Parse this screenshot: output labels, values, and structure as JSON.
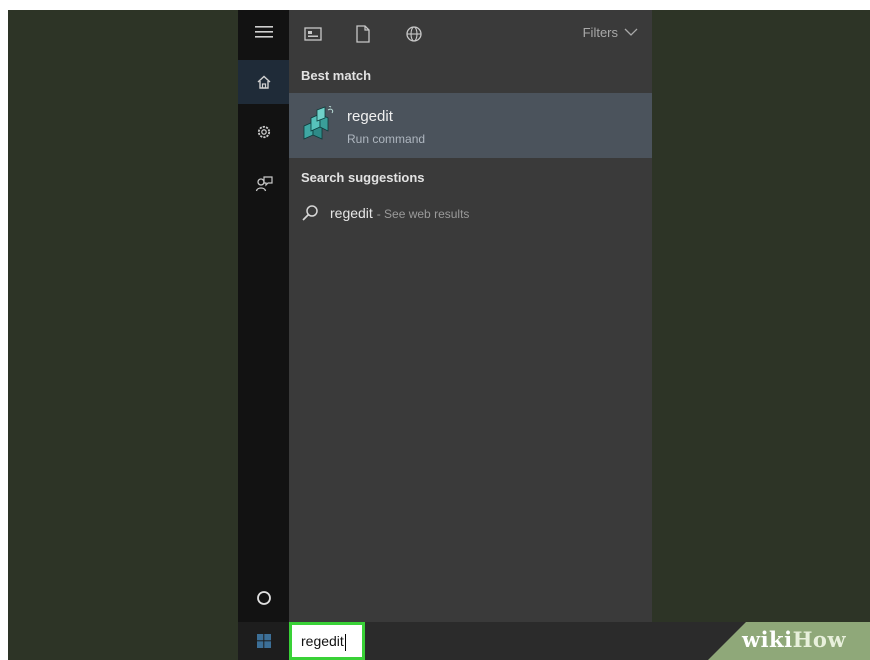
{
  "topbar": {
    "icons": [
      "apps-icon",
      "documents-icon",
      "web-icon"
    ],
    "filters_label": "Filters"
  },
  "sidebar": {
    "items": [
      "menu-icon",
      "home-icon",
      "settings-icon",
      "feedback-icon"
    ],
    "bottom": [
      "cortana-icon",
      "windows-start-icon"
    ]
  },
  "best_match": {
    "label": "Best match",
    "app_name": "regedit",
    "app_type": "Run command"
  },
  "suggestions": {
    "label": "Search suggestions",
    "items": [
      {
        "term": "regedit",
        "hint": "- See web results"
      }
    ]
  },
  "search": {
    "value": "regedit"
  },
  "watermark": {
    "wiki": "wiki",
    "how": "How"
  },
  "colors": {
    "background": "#2d3426",
    "rail": "#121212",
    "panel": "#3a3a3a",
    "selected_item": "#4b535c",
    "highlight_border": "#39d137"
  }
}
